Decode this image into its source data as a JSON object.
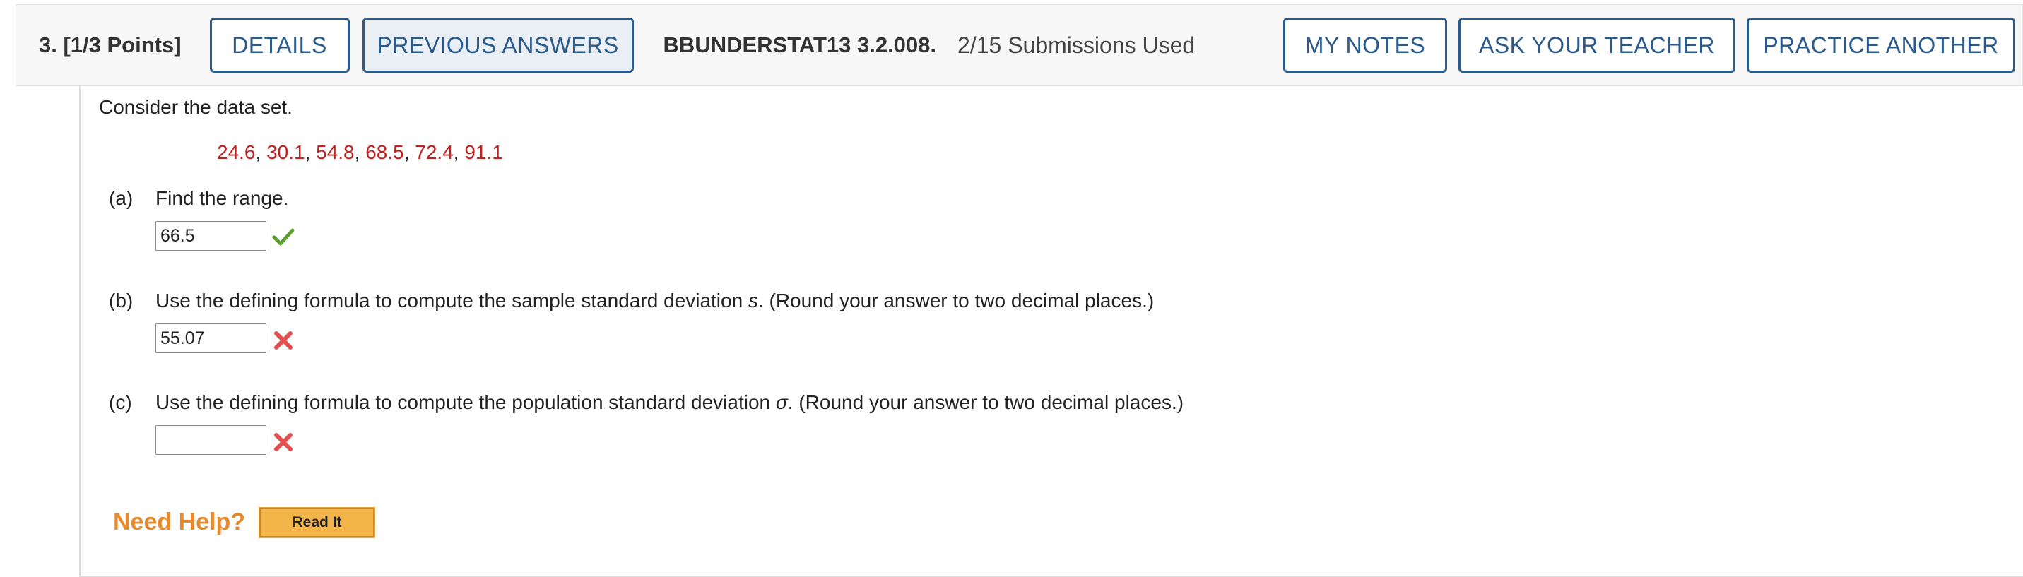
{
  "header": {
    "question_number": "3. [1/3 Points]",
    "details_label": "DETAILS",
    "previous_answers_label": "PREVIOUS ANSWERS",
    "problem_code": "BBUNDERSTAT13 3.2.008.",
    "submissions": "2/15 Submissions Used",
    "my_notes_label": "MY NOTES",
    "ask_teacher_label": "ASK YOUR TEACHER",
    "practice_another_label": "PRACTICE ANOTHER"
  },
  "problem": {
    "intro": "Consider the data set.",
    "data_values": [
      "24.6",
      "30.1",
      "54.8",
      "68.5",
      "72.4",
      "91.1"
    ],
    "separator": ", ",
    "parts": [
      {
        "label": "(a)",
        "prompt_before": "Find the range.",
        "symbol": "",
        "prompt_after": "",
        "answer_value": "66.5",
        "status": "correct"
      },
      {
        "label": "(b)",
        "prompt_before": "Use the defining formula to compute the sample standard deviation ",
        "symbol": "s",
        "prompt_after": ". (Round your answer to two decimal places.)",
        "answer_value": "55.07",
        "status": "incorrect"
      },
      {
        "label": "(c)",
        "prompt_before": "Use the defining formula to compute the population standard deviation ",
        "symbol": "σ",
        "prompt_after": ". (Round your answer to two decimal places.)",
        "answer_value": "",
        "status": "incorrect"
      }
    ]
  },
  "help": {
    "need_help_label": "Need Help?",
    "read_it_label": "Read It"
  },
  "colors": {
    "accent": "#2a5b8c",
    "data_red": "#c0201e",
    "correct_green": "#5aa02c",
    "incorrect_red": "#e05050",
    "help_orange": "#e68a2e"
  }
}
